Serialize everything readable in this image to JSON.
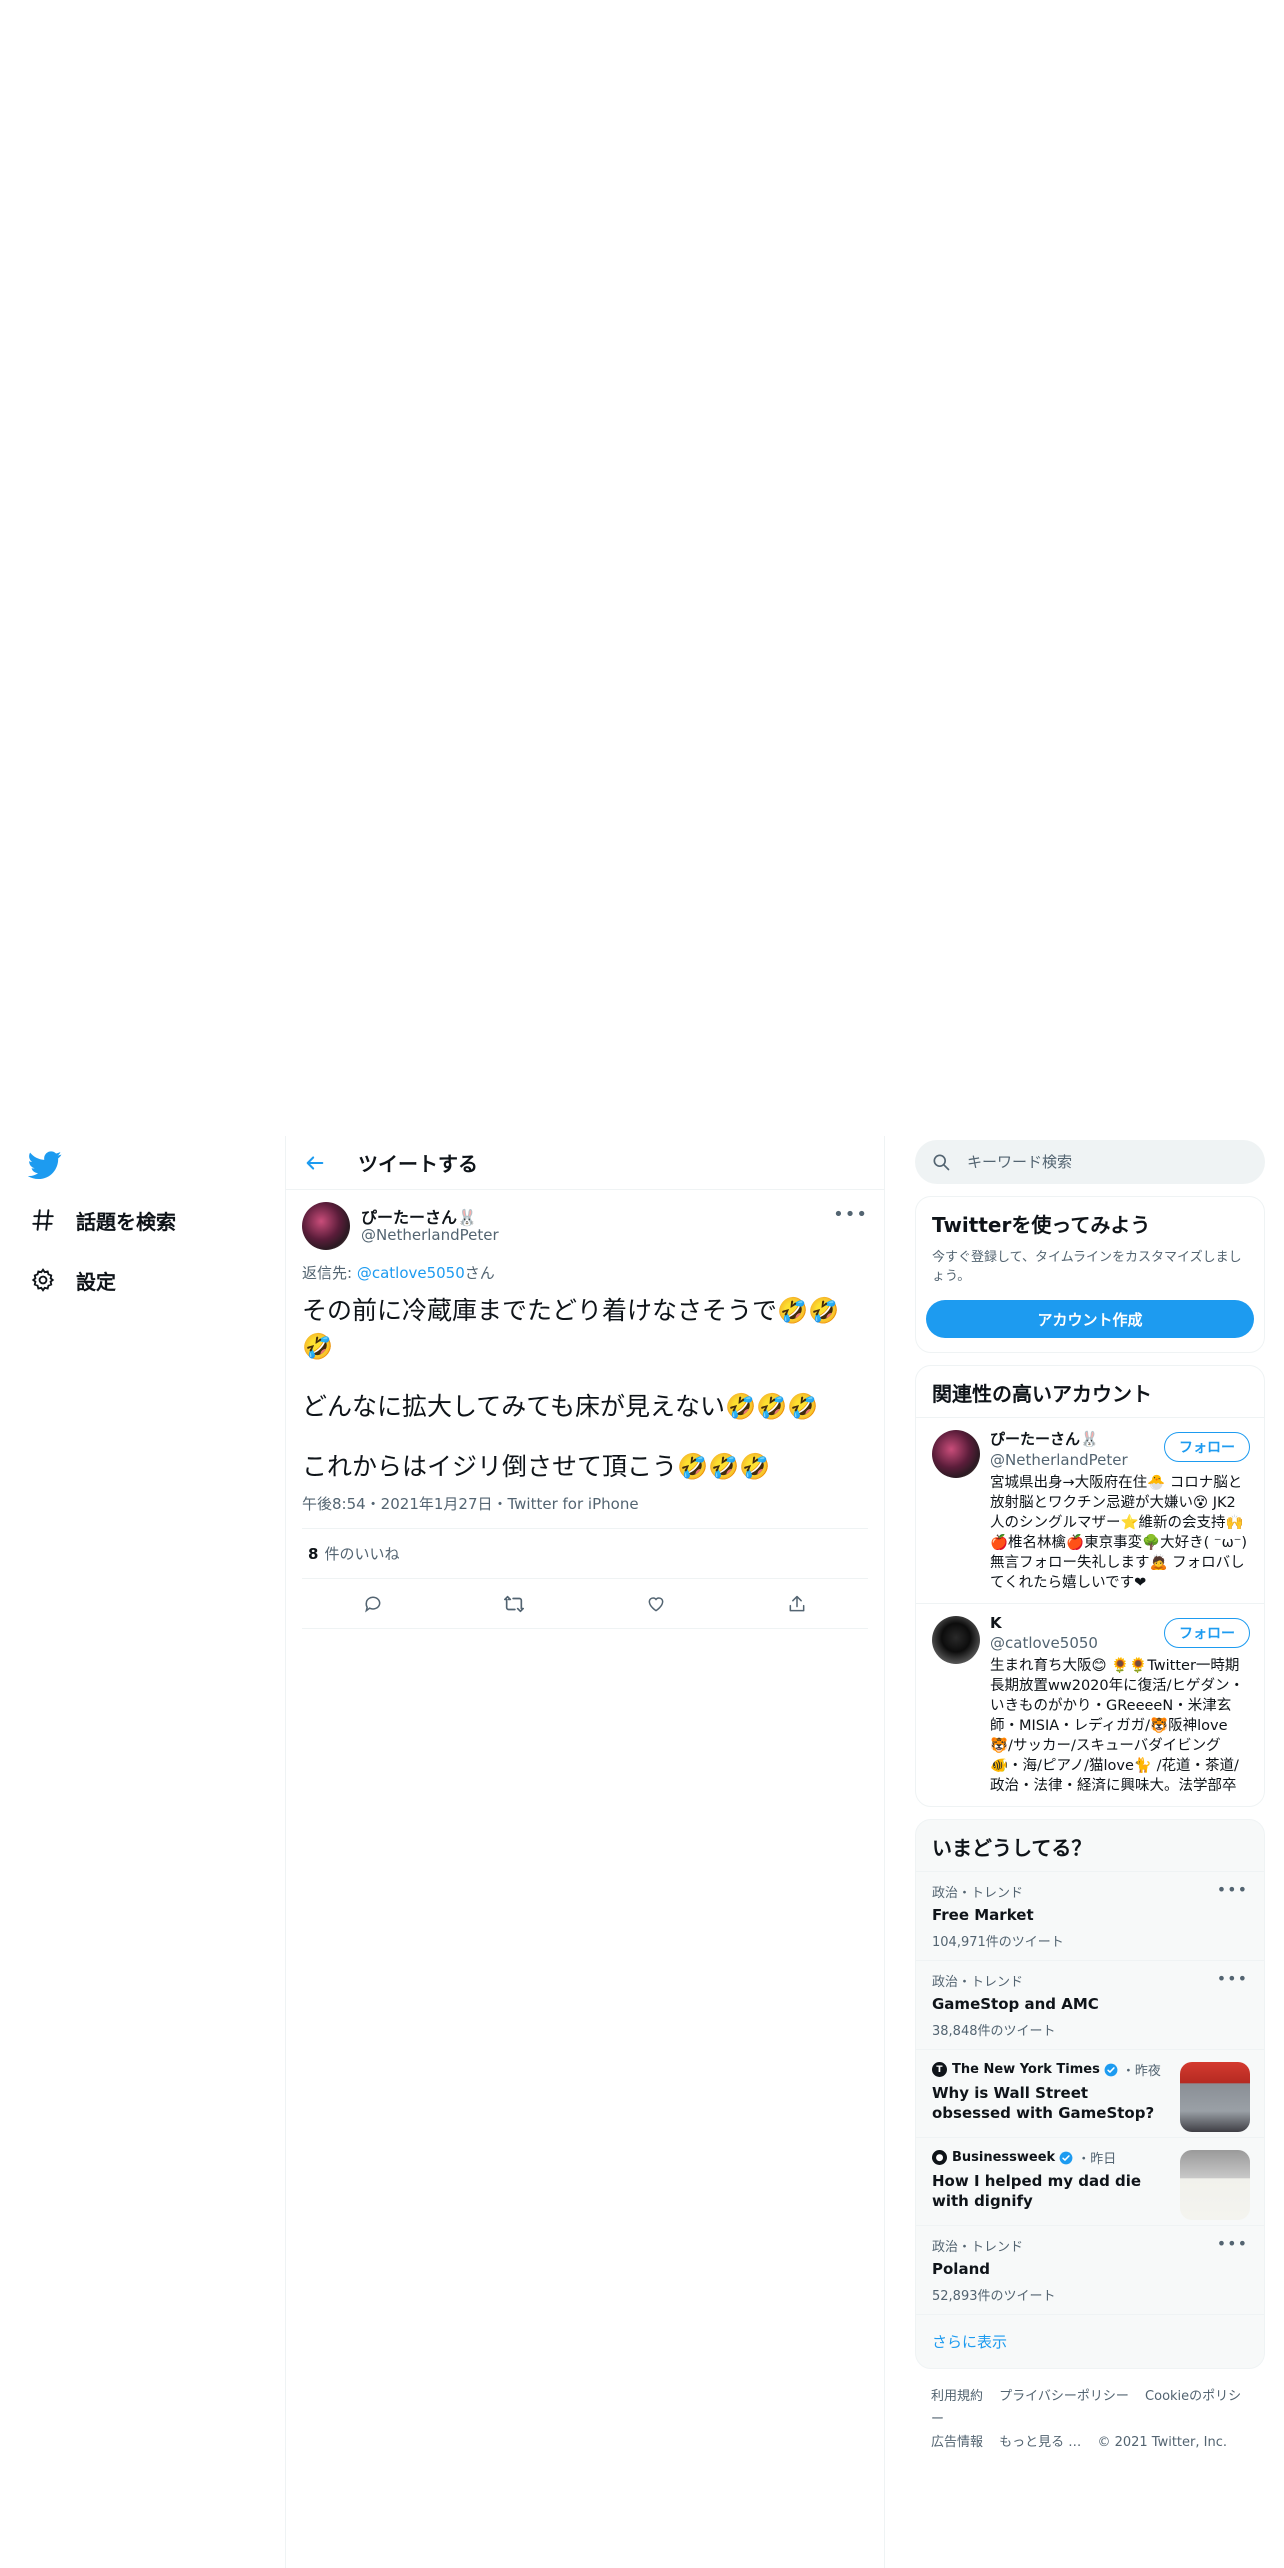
{
  "nav": {
    "logo": "twitter-bird-icon",
    "items": [
      {
        "label": "話題を検索",
        "icon": "hashtag-icon"
      },
      {
        "label": "設定",
        "icon": "gear-icon"
      }
    ]
  },
  "header": {
    "title": "ツイートする"
  },
  "tweet": {
    "display_name": "ぴーたーさん🐰",
    "handle": "@NetherlandPeter",
    "reply_prefix": "返信先: ",
    "reply_to": "@catlove5050",
    "reply_suffix": "さん",
    "lines": [
      "その前に冷蔵庫までたどり着けなさそうで🤣🤣🤣",
      "どんなに拡大してみても床が見えない🤣🤣🤣",
      "これからはイジリ倒させて頂こう🤣🤣🤣"
    ],
    "meta": "午後8:54・2021年1月27日・Twitter for iPhone",
    "likes_count": "8",
    "likes_label": "件のいいね",
    "more": "•••"
  },
  "search": {
    "placeholder": "キーワード検索"
  },
  "signup": {
    "title": "Twitterを使ってみよう",
    "desc": "今すぐ登録して、タイムラインをカスタマイズしましょう。",
    "button": "アカウント作成"
  },
  "related": {
    "title": "関連性の高いアカウント",
    "accounts": [
      {
        "name": "ぴーたーさん🐰",
        "handle": "@NetherlandPeter",
        "button": "フォロー",
        "bio": "宮城県出身→大阪府在住🐣 コロナ脳と放射脳とワクチン忌避が大嫌い😵 JK2人のシングルマザー⭐維新の会支持🙌 🍎椎名林檎🍎東京事変🌳大好き( ⁻ω⁻) 無言フォロー失礼します🙇 フォロバしてくれたら嬉しいです❤"
      },
      {
        "name": "K",
        "handle": "@catlove5050",
        "button": "フォロー",
        "bio": "生まれ育ち大阪😊 🌻🌻Twitter一時期長期放置ww2020年に復活/ヒゲダン・いきものがかり・GReeeeN・米津玄師・MISIA・レディガガ/🐯阪神love🐯/サッカー/スキューバダイビング🐠・海/ピアノ/猫love🐈 /花道・茶道/政治・法律・経済に興味大。法学部卒"
      }
    ]
  },
  "trends": {
    "title": "いまどうしてる？",
    "items": [
      {
        "category": "政治・トレンド",
        "name": "Free Market",
        "count": "104,971件のツイート"
      },
      {
        "category": "政治・トレンド",
        "name": "GameStop and AMC",
        "count": "38,848件のツイート"
      },
      {
        "source": "The New York Times",
        "time": "・昨夜",
        "headline": "Why is Wall Street obsessed with GameStop?"
      },
      {
        "source": "Businessweek",
        "time": "・昨日",
        "headline": "How I helped my dad die with dignify"
      },
      {
        "category": "政治・トレンド",
        "name": "Poland",
        "count": "52,893件のツイート"
      }
    ],
    "show_more": "さらに表示"
  },
  "footer": {
    "links": [
      "利用規約",
      "プライバシーポリシー",
      "Cookieのポリシー",
      "広告情報",
      "もっと見る …"
    ],
    "copyright": "© 2021 Twitter, Inc."
  },
  "colors": {
    "accent": "#1d9bf0",
    "text": "#0f1419",
    "muted": "#536471",
    "border": "#eff3f4"
  }
}
